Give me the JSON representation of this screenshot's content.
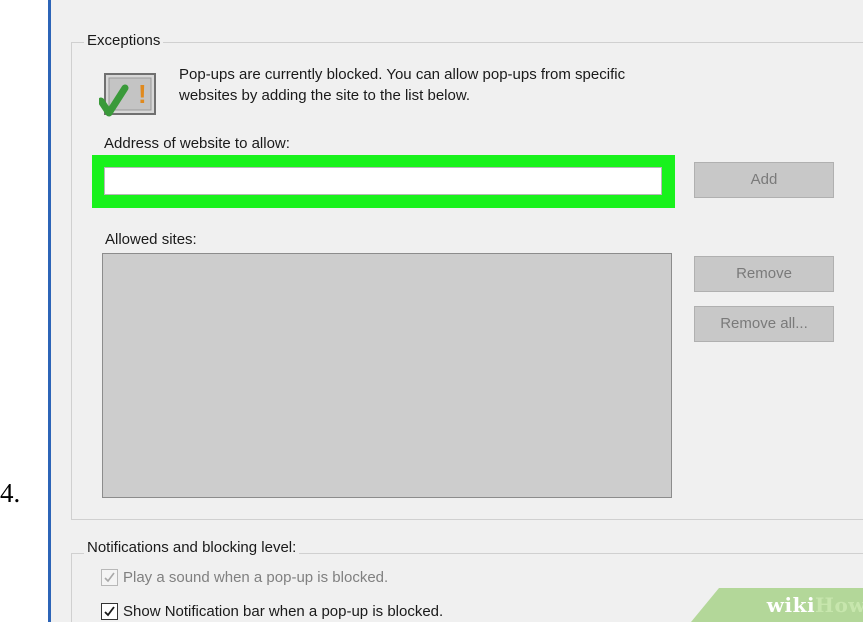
{
  "step": {
    "number": "4."
  },
  "exceptions": {
    "title": "Exceptions",
    "info_line1": "Pop-ups are currently blocked.  You can allow pop-ups from specific",
    "info_line2": "websites by adding the site to the list below.",
    "icon": "shield-check-warning-icon",
    "address_label": "Address of website to allow:",
    "address_value": "",
    "add_label": "Add",
    "allowed_label": "Allowed sites:",
    "allowed_sites": [],
    "remove_label": "Remove",
    "remove_all_label": "Remove all..."
  },
  "notifications": {
    "title": "Notifications and blocking level:",
    "sound_label": "Play a sound when a pop-up is blocked.",
    "sound_checked": true,
    "sound_disabled": true,
    "notification_bar_label": "Show Notification bar when a pop-up is blocked.",
    "notification_bar_checked": true
  },
  "watermark": {
    "part1": "wiki",
    "part2": "How"
  },
  "colors": {
    "highlight": "#19f21c",
    "dialog_bg": "#f0f0f0",
    "border_accent": "#2c64b7",
    "check_green": "#3a9a3a"
  }
}
